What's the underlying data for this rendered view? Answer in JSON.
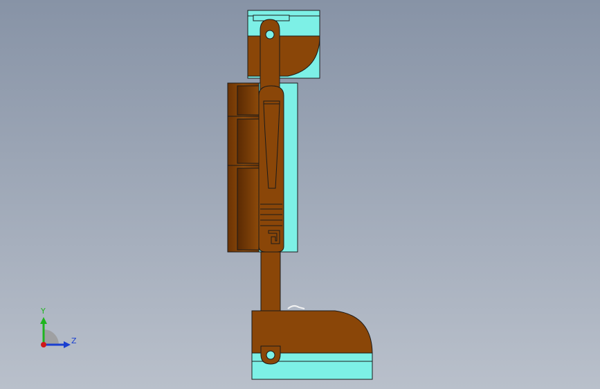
{
  "view": {
    "background_top": "#8793a6",
    "background_bottom": "#b9c0cb"
  },
  "triad": {
    "y_label": "Y",
    "z_label": "Z",
    "y_color": "#1fb51f",
    "z_color": "#1a3fd0",
    "origin_color": "#d01818"
  },
  "colors": {
    "cut_face": "#7df0e6",
    "section": "#8a4608",
    "section_dark": "#6e3406",
    "edge": "#1a1a1a"
  }
}
